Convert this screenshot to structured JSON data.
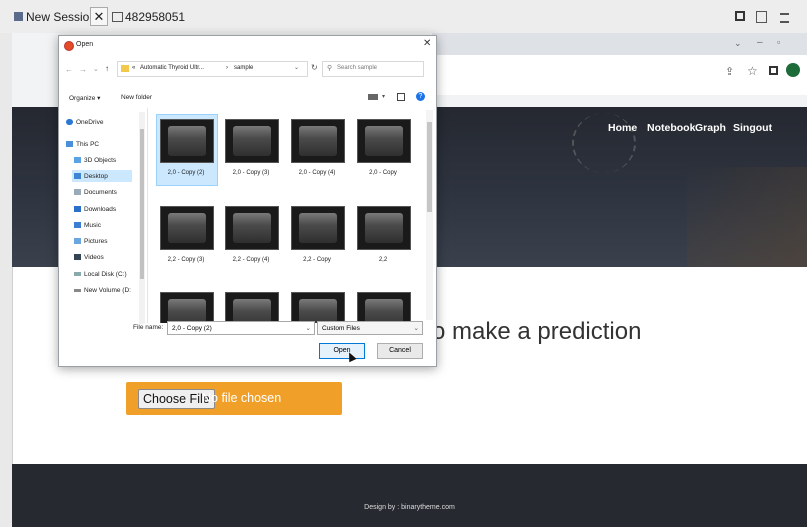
{
  "session": {
    "tab1_label": "New Session",
    "tab2_label": "482958051"
  },
  "dialog": {
    "title": "Open",
    "path_root": "«",
    "path_folder": "Automatic Thyroid Ultr...",
    "path_sep": "›",
    "path_sub": "sample",
    "search_placeholder": "Search sample",
    "organize_label": "Organize",
    "new_folder_label": "New folder",
    "nav_items": [
      {
        "label": "OneDrive",
        "icon": "cloud-icon"
      },
      {
        "label": "This PC",
        "icon": "computer-icon"
      },
      {
        "label": "3D Objects",
        "icon": "cube-icon"
      },
      {
        "label": "Desktop",
        "icon": "desktop-icon"
      },
      {
        "label": "Documents",
        "icon": "document-icon"
      },
      {
        "label": "Downloads",
        "icon": "download-icon"
      },
      {
        "label": "Music",
        "icon": "music-icon"
      },
      {
        "label": "Pictures",
        "icon": "picture-icon"
      },
      {
        "label": "Videos",
        "icon": "video-icon"
      },
      {
        "label": "Local Disk (C:)",
        "icon": "drive-icon"
      },
      {
        "label": "New Volume (D:",
        "icon": "drive-icon"
      }
    ],
    "selected_nav": "Desktop",
    "files": [
      "2,0 - Copy (2)",
      "2,0 - Copy (3)",
      "2,0 - Copy (4)",
      "2,0 - Copy",
      "2,2 - Copy (3)",
      "2,2 - Copy (4)",
      "2,2 - Copy",
      "2,2",
      "",
      "",
      "",
      ""
    ],
    "selected_file": "2,0 - Copy (2)",
    "filename_label": "File name:",
    "filename_value": "2,0 - Copy (2)",
    "filter_value": "Custom Files",
    "open_label": "Open",
    "cancel_label": "Cancel"
  },
  "site": {
    "nav": [
      "Home",
      "Notebook",
      "Graph",
      "Singout"
    ],
    "prompt_text": "o make a prediction",
    "choose_file_label": "Choose File",
    "no_file_text": "No file chosen",
    "footer_text": "Design by : binarytheme.com"
  },
  "colors": {
    "hero": "#2e3440",
    "accent_orange": "#f0a029",
    "footer": "#262930",
    "selection_blue": "#cce8ff"
  }
}
